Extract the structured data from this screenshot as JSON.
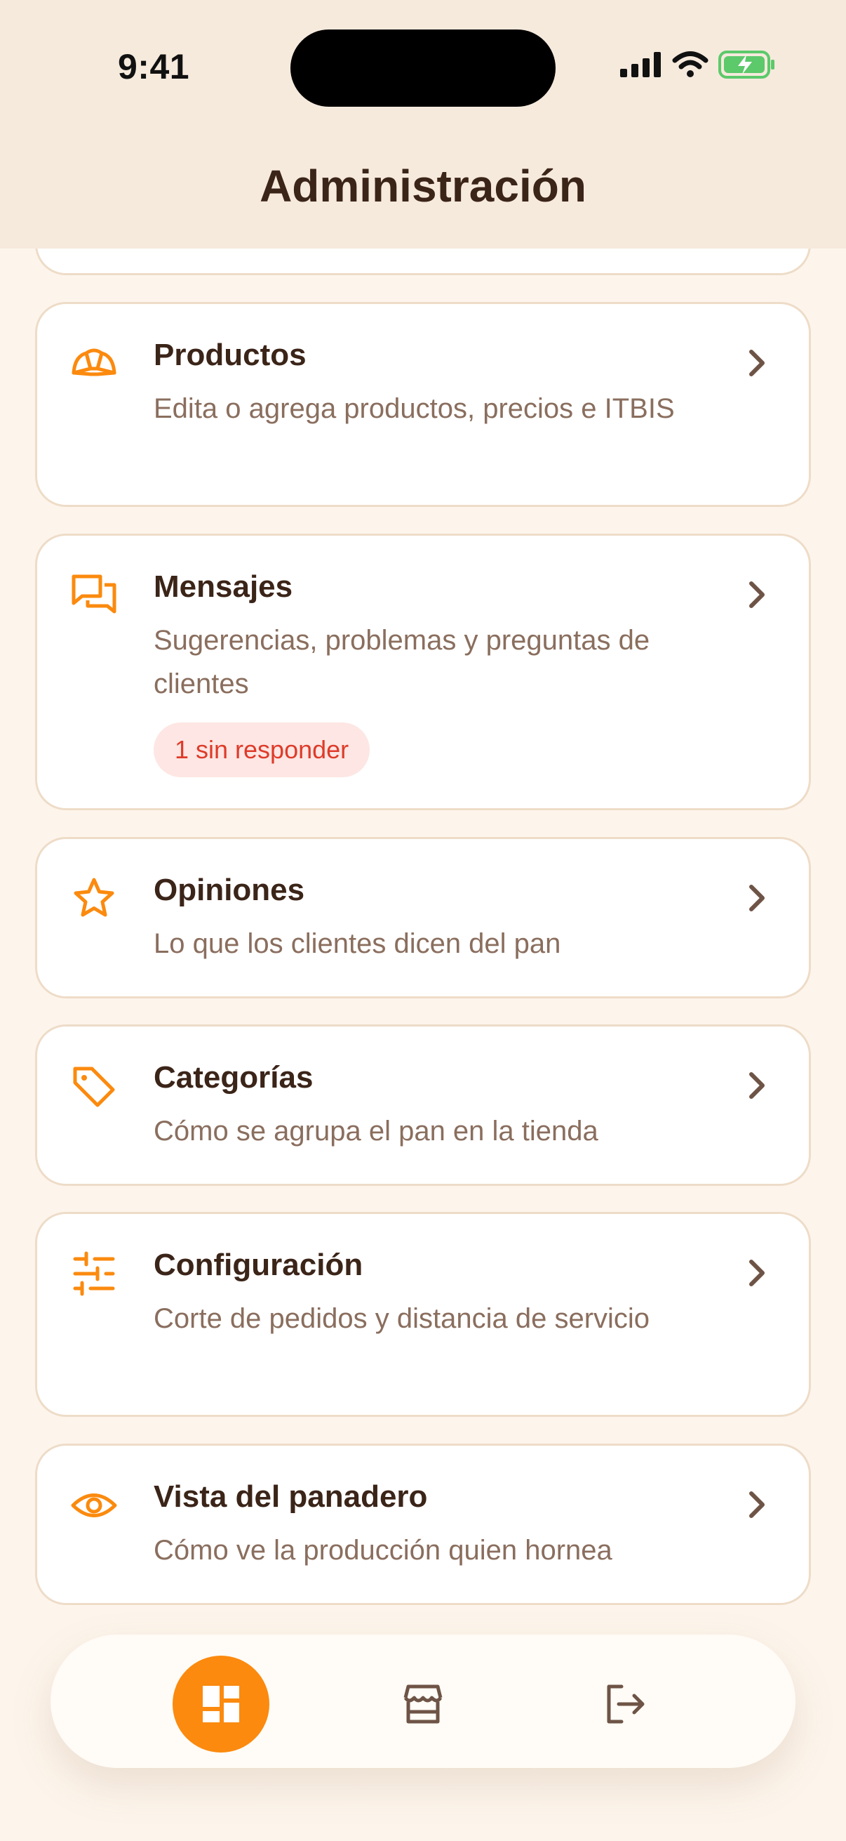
{
  "status_bar": {
    "time": "9:41"
  },
  "header": {
    "title": "Administración"
  },
  "menu": [
    {
      "title": "Productos",
      "description": "Edita o agrega productos, precios e ITBIS",
      "icon": "croissant-icon"
    },
    {
      "title": "Mensajes",
      "description": "Sugerencias, problemas y preguntas de clientes",
      "icon": "chat-bubbles-icon",
      "badge": "1 sin responder"
    },
    {
      "title": "Opiniones",
      "description": "Lo que los clientes dicen del pan",
      "icon": "star-icon"
    },
    {
      "title": "Categorías",
      "description": "Cómo se agrupa el pan en la tienda",
      "icon": "tag-icon"
    },
    {
      "title": "Configuración",
      "description": "Corte de pedidos y distancia de servicio",
      "icon": "sliders-icon"
    },
    {
      "title": "Vista del panadero",
      "description": "Cómo ve la producción quien hornea",
      "icon": "eye-icon"
    }
  ],
  "bottom_nav": [
    {
      "icon": "dashboard-icon",
      "active": true
    },
    {
      "icon": "store-icon",
      "active": false
    },
    {
      "icon": "logout-icon",
      "active": false
    }
  ],
  "colors": {
    "accent": "#FB8A0E",
    "text": "#3B2418",
    "muted": "#8A6E5E",
    "badge_text": "#DE3B2A",
    "badge_bg": "#FDE6E3",
    "background": "#FDF5EC"
  }
}
